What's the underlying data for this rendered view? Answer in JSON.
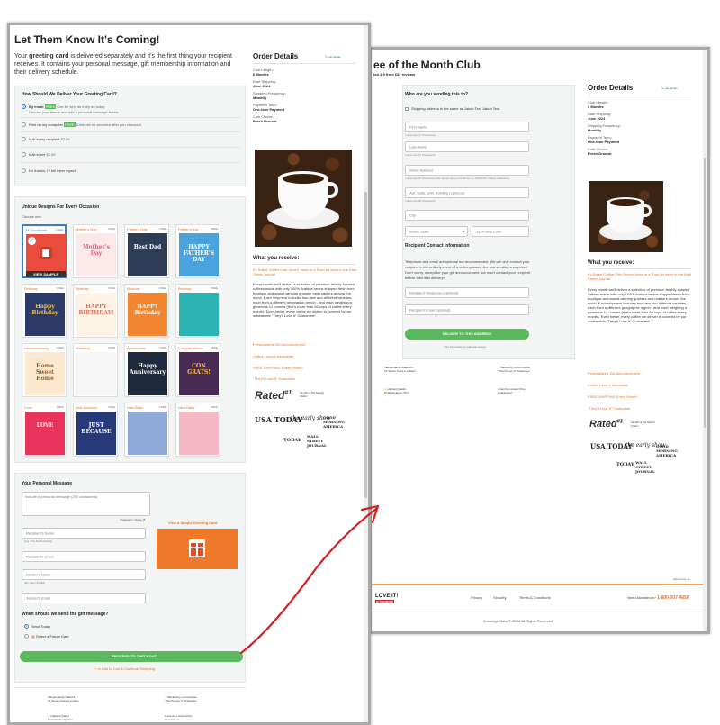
{
  "checkout": {
    "heading": "Let Them Know It's Coming!",
    "intro_prefix": "Your ",
    "intro_bold": "greeting card",
    "intro_rest": " is delivered separately and it's the first thing your recipient receives. It contains your personal message, gift membership information and their delivery schedule.",
    "delivery": {
      "title": "How Should We Deliver Your Greeting Card?",
      "options": [
        {
          "label": "By email",
          "badge": "FREE",
          "note": "Can be sent as early as today.",
          "sub": "Choose your theme and add a personal message below."
        },
        {
          "label": "Print on my computer",
          "badge": "FREE",
          "note": "A link will be provided after you checkout."
        },
        {
          "label": "Mail to my recipient",
          "note": "$2.99"
        },
        {
          "label": "Mail to me",
          "note": "$2.99"
        },
        {
          "label": "No thanks, I'll tell them myself"
        }
      ]
    },
    "designs": {
      "title": "Unique Designs For Every Occasion",
      "choose_label": "Choose one:",
      "view_sample": "VIEW SAMPLE",
      "cards": [
        {
          "name": "All Occasions",
          "price": "FREE",
          "text": "",
          "bg": "#e94b3c",
          "fg": "#ffffff"
        },
        {
          "name": "Mother's Day",
          "price": "FREE",
          "text": "Mother's Day",
          "bg": "#fbe9ea",
          "fg": "#e0607a"
        },
        {
          "name": "Father's Day",
          "price": "FREE",
          "text": "Best Dad",
          "bg": "#2f3c55",
          "fg": "#ffffff"
        },
        {
          "name": "Father's Day",
          "price": "FREE",
          "text": "HAPPY FATHER'S DAY",
          "bg": "#4aa3dd",
          "fg": "#ffffff"
        },
        {
          "name": "Birthday",
          "price": "FREE",
          "text": "Happy Birthday",
          "bg": "#2b3a66",
          "fg": "#f6c453"
        },
        {
          "name": "Birthday",
          "price": "FREE",
          "text": "HAPPY BIRTHDAY!",
          "bg": "#fdf4e6",
          "fg": "#e46d58"
        },
        {
          "name": "Birthday",
          "price": "FREE",
          "text": "HAPPY Birthday",
          "bg": "#f2852f",
          "fg": "#ffffff"
        },
        {
          "name": "Birthday",
          "price": "FREE",
          "text": "",
          "bg": "#2bb3b1",
          "fg": "#ffffff"
        },
        {
          "name": "Housewarming",
          "price": "FREE",
          "text": "Home Sweet Home",
          "bg": "#fde9d0",
          "fg": "#8a5a2b"
        },
        {
          "name": "Wedding",
          "price": "FREE",
          "text": "",
          "bg": "#f6f6f6",
          "fg": "#999999"
        },
        {
          "name": "Anniversary",
          "price": "FREE",
          "text": "Happy Anniversary",
          "bg": "#1f2a3e",
          "fg": "#ffffff"
        },
        {
          "name": "Congratulations",
          "price": "FREE",
          "text": "CON GRATS!",
          "bg": "#4a2b55",
          "fg": "#f6c453"
        },
        {
          "name": "Love",
          "price": "FREE",
          "text": "LOVE",
          "bg": "#e8335a",
          "fg": "#ffffff"
        },
        {
          "name": "Just Because",
          "price": "FREE",
          "text": "JUST BECAUSE",
          "bg": "#263a7a",
          "fg": "#ffffff"
        },
        {
          "name": "New Baby",
          "price": "FREE",
          "text": "",
          "bg": "#8fa9d9",
          "fg": "#ffffff"
        },
        {
          "name": "New Baby",
          "price": "FREE",
          "text": "",
          "bg": "#f5b8c6",
          "fg": "#ffffff"
        }
      ]
    },
    "message": {
      "title": "Your Personal Message",
      "placeholder": "Include a personal message (200 characters)",
      "chars_left": "Characters: Space ▼",
      "recipient_name_ph": "Recipient's Name",
      "recipient_name_hint": "(e.g. The Smith Family)",
      "recipient_email_ph": "Recipient's Email",
      "sender_name_ph": "Sender's Name",
      "sender_name_hint": "(Ex. Mom & Dad)",
      "sender_email_ph": "Sender's Email",
      "view_sample_card": "View a Simple Greeting Card",
      "when_title": "When should we send the gift message?",
      "send_today": "Send Today",
      "select_future": "Select a Future Date",
      "proceed_button": "PROCEED TO CHECKOUT",
      "add_to_cart": "+ or Add to Cart & Continue Shopping"
    },
    "guarantees": [
      {
        "title": "Independently Rated #1",
        "sub": "for Seven Years in a Row!"
      },
      {
        "title": "Backed by our exclusive",
        "sub": "\"They'll Love It\" Guarantee"
      },
      {
        "title": "Highest Quality",
        "sub": "Products Every Time"
      },
      {
        "title": "Get the Lowest Price",
        "sub": "Guaranteed"
      }
    ]
  },
  "order": {
    "title": "Order Details",
    "edit": "✎ edit details",
    "rows": [
      {
        "label": "Club Length:",
        "value": "6 Months"
      },
      {
        "label": "Start Shipping:",
        "value": "June 2024"
      },
      {
        "label": "Shipping Frequency:",
        "value": "Monthly"
      },
      {
        "label": "Payment Term:",
        "value": "One-time Payment"
      },
      {
        "label": "Club Choice:",
        "value": "Fresh Ground"
      }
    ],
    "receive_title": "What you receive:",
    "receive_highlight": "#1 Rated Coffee Club Seven Years in a Row! As seen in the Wall Street Journal",
    "receive_body": "Every month we'll deliver a selection of premium freshly-roasted coffees made with only 100% Arabica beans shipped fresh from boutique and award-winning growers and roasters around the world. Each shipment includes two new and different varieties - each from a different geographic region - and each weighing a generous 12 ounces (that's more than 60 cups of coffee every month). Even better, every coffee we deliver is covered by our unbeatable \"They'll Love It\" Guarantee!",
    "accordions": [
      "Personalized Gift Announcement",
      "Coffee Lover's Newsletter",
      "FREE SHIPPING Every Month!",
      "\"They'll Love It\" Guarantee"
    ],
    "rated_text": "Rated",
    "rated_sub": "for Gift of the Month Clubs!",
    "press": [
      "USA TODAY",
      "the early show",
      "GOOD MORNING AMERICA",
      "TODAY",
      "WALL STREET JOURNAL"
    ]
  },
  "shipping": {
    "page_title": "ee of the Month Club",
    "rating_text": "ted 4.9 from 632 reviews",
    "who_title": "Who are you sending this to?",
    "same_address": "Shipping address is the same as Jakub Test Jakub Test.",
    "first_name": "First Name",
    "first_hint": "(maximum 17 characters)",
    "last_name": "Last Name",
    "last_hint": "(maximum 17 characters)",
    "street": "Street Address",
    "street_hint": "(maximum 35 characters) We cannot ship to P.O Boxes or APO/FPO military addresses",
    "apt": "Apt, Suite, Unit, Building (optional)",
    "apt_hint": "(maximum 35 characters)",
    "city": "City",
    "state": "Select State",
    "zip": "Zip/Postal Code",
    "contact_title": "Recipient Contact Information",
    "contact_body": "Telephone and email are optional but recommended. We will only contact your recipient in the unlikely event of a delivery issue. Are you sending a surprise? Don't worry, except for your gift announcement, we won't contact your recipient before their first delivery!",
    "phone_ph": "Recipient Telephone (optional)",
    "email_ph": "Recipient Email (optional)",
    "deliver_button": "DELIVER TO THIS ADDRESS",
    "secure_note": "Your information is safe and secure",
    "back_to_top": "back to top ▲",
    "footer_links": [
      "Privacy",
      "Security",
      "Terms & Conditions"
    ],
    "assistance": "Need Assistance?",
    "phone": "1-800-507-4650",
    "copyright": "Amazing Clubs © 2024 All Rights Reserved",
    "love_it": "LOVE IT!",
    "guarantee": "GUARANTEE"
  },
  "colors": {
    "accent": "#e8732a",
    "green": "#5cb85c",
    "arrow": "#d62020"
  }
}
